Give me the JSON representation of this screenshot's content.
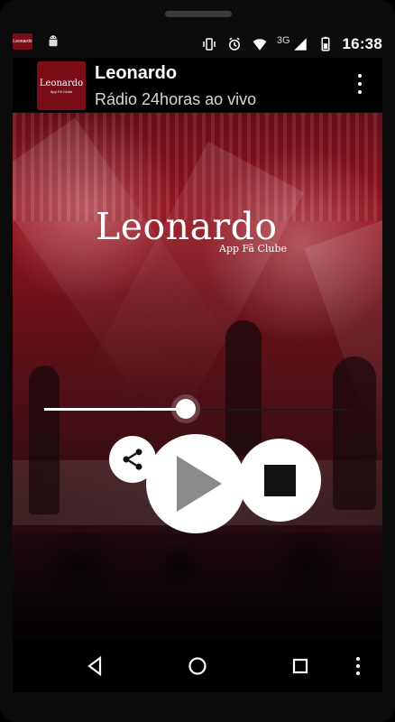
{
  "status": {
    "time": "16:38",
    "network": "3G",
    "icons": [
      "notification-logo-icon",
      "android-icon",
      "vibrate-icon",
      "alarm-icon",
      "wifi-icon",
      "signal-icon",
      "battery-icon"
    ]
  },
  "header": {
    "title": "Leonardo",
    "subtitle": "Rádio 24horas ao vivo",
    "app_icon_logo": "Leonardo",
    "app_icon_sublogo": "App Fã Clube"
  },
  "hero": {
    "logo": "Leonardo",
    "sublogo": "App Fã Clube"
  },
  "player": {
    "progress": 0.45
  },
  "colors": {
    "brand": "#7b0d16",
    "background": "#000000",
    "controls": "#ffffff"
  }
}
